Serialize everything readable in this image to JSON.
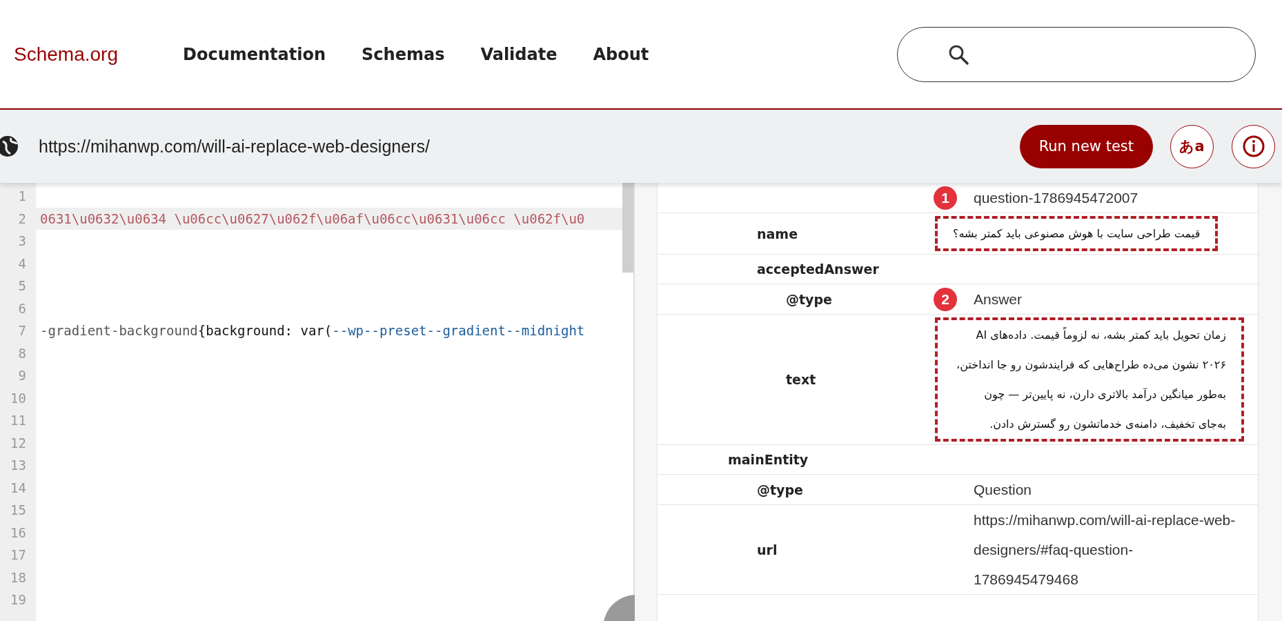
{
  "header": {
    "logo": "Schema.org",
    "nav": [
      "Documentation",
      "Schemas",
      "Validate",
      "About"
    ]
  },
  "toolbar": {
    "url": "https://mihanwp.com/will-ai-replace-web-designers/",
    "run_button": "Run new test",
    "language_button": "あa"
  },
  "editor": {
    "lines": [
      {
        "number": "1",
        "highlighted": false
      },
      {
        "number": "2",
        "highlighted": true,
        "tokens": [
          {
            "kind": "string",
            "text": "0631\\u0632\\u0634 \\u06cc\\u0627\\u062f\\u06af\\u06cc\\u0631\\u06cc \\u062f\\u0"
          }
        ]
      },
      {
        "number": "3",
        "highlighted": false
      },
      {
        "number": "4",
        "highlighted": false
      },
      {
        "number": "5",
        "highlighted": false
      },
      {
        "number": "6",
        "highlighted": false
      },
      {
        "number": "7",
        "highlighted": false,
        "tokens": [
          {
            "kind": "selector",
            "text": "-gradient-background"
          },
          {
            "kind": "plain",
            "text": "{background: var("
          },
          {
            "kind": "variable",
            "text": "--wp--preset--gradient--midnight"
          }
        ]
      },
      {
        "number": "8",
        "highlighted": false
      },
      {
        "number": "9",
        "highlighted": false
      },
      {
        "number": "10",
        "highlighted": false
      },
      {
        "number": "11",
        "highlighted": false
      },
      {
        "number": "12",
        "highlighted": false
      },
      {
        "number": "13",
        "highlighted": false
      },
      {
        "number": "14",
        "highlighted": false
      },
      {
        "number": "15",
        "highlighted": false
      },
      {
        "number": "16",
        "highlighted": false
      },
      {
        "number": "17",
        "highlighted": false
      },
      {
        "number": "18",
        "highlighted": false
      },
      {
        "number": "19",
        "highlighted": false
      }
    ]
  },
  "results": {
    "rows": [
      {
        "kind": "group",
        "children": [
          {
            "kind": "value",
            "value": "question-1786945472007",
            "annotation": "1",
            "boxed": false
          },
          {
            "kind": "value",
            "key": "name",
            "value": "قیمت طراحی سایت با هوش مصنوعی باید کمتر بشه؟",
            "rtl": true,
            "boxed": true
          },
          {
            "kind": "group",
            "key": "acceptedAnswer",
            "children": [
              {
                "kind": "value",
                "key": "@type",
                "value": "Answer",
                "annotation": "2",
                "boxed": false
              },
              {
                "kind": "value",
                "key": "text",
                "value": "زمان تحویل باید کمتر بشه، نه لزوماً قیمت. داده‌های AI ۲۰۲۶ نشون می‌ده طراح‌هایی که فرایندشون رو جا انداختن، به‌طور میانگین درآمد بالاتری دارن، نه پایین‌تر — چون به‌جای تخفیف، دامنه‌ی خدماتشون رو گسترش دادن.",
                "rtl": true,
                "boxed": true
              }
            ]
          }
        ]
      },
      {
        "kind": "group",
        "key": "mainEntity",
        "children": [
          {
            "kind": "value",
            "key": "@type",
            "value": "Question",
            "boxed": false
          },
          {
            "kind": "value",
            "key": "url",
            "value": "https://mihanwp.com/will-ai-replace-web-designers/#faq-question-1786945479468",
            "boxed": false
          }
        ]
      }
    ]
  }
}
